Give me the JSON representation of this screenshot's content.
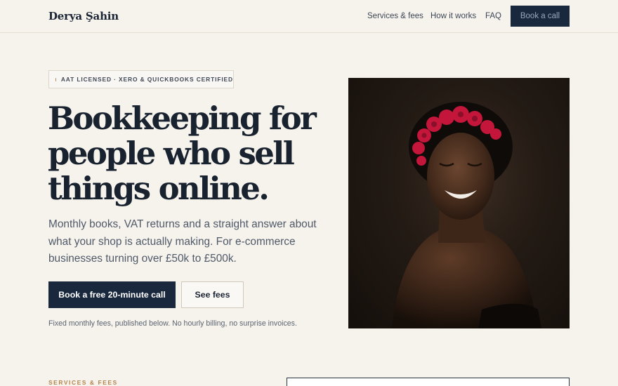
{
  "brand": {
    "name": "Derya Şahin"
  },
  "nav": {
    "items": [
      "Services & fees",
      "How it works",
      "FAQ"
    ],
    "cta": "Book a call"
  },
  "hero": {
    "badge": "AAT LICENSED · XERO & QUICKBOOKS CERTIFIED",
    "title": "Bookkeeping for people who sell things online.",
    "subtitle": "Monthly books, VAT returns and a straight answer about what your shop is actually making. For e-commerce businesses turning over £50k to £500k.",
    "primary_button": "Book a free 20-minute call",
    "secondary_button": "See fees",
    "fine_print": "Fixed monthly fees, published below. No hourly billing, no surprise invoices."
  },
  "section": {
    "label": "SERVICES & FEES"
  },
  "colors": {
    "background": "#f6f3ed",
    "navy": "#19283d",
    "accent": "#b3844e"
  }
}
